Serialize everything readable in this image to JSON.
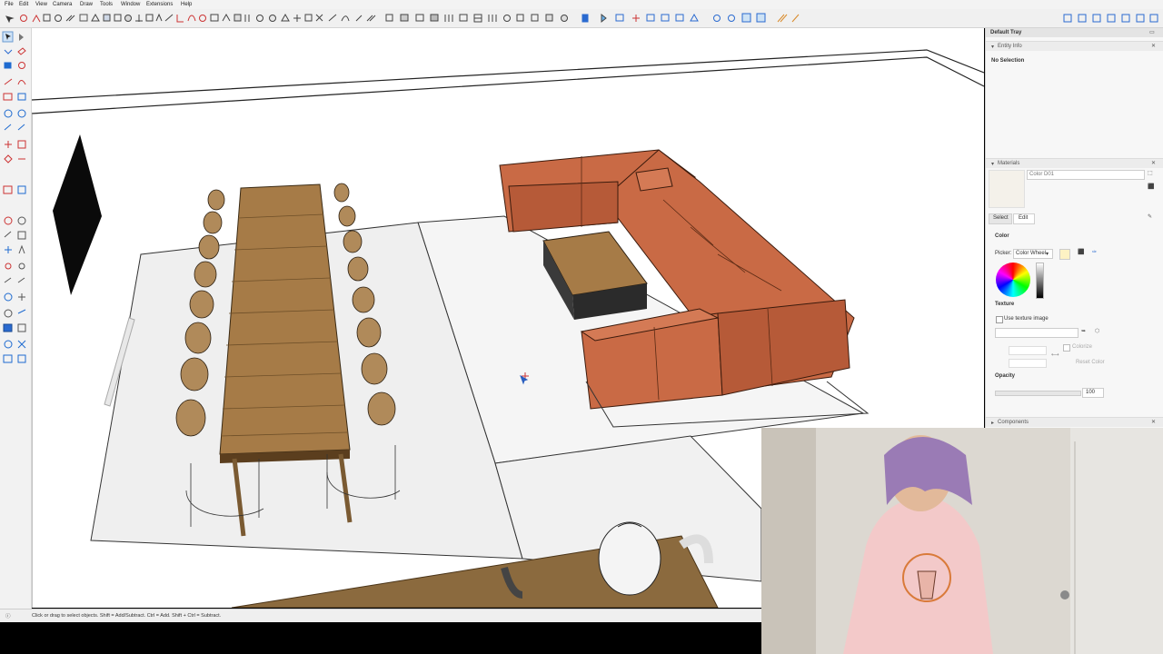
{
  "menu": [
    "File",
    "Edit",
    "View",
    "Camera",
    "Draw",
    "Tools",
    "Window",
    "Extensions",
    "Help"
  ],
  "tray": {
    "title": "Default Tray",
    "entity_info": {
      "header": "Entity Info",
      "selection": "No Selection"
    },
    "materials": {
      "header": "Materials",
      "material_name": "Color D01",
      "tabs": [
        "Select",
        "Edit"
      ],
      "color_label": "Color",
      "picker_label": "Picker:",
      "picker_value": "Color Wheel",
      "texture_label": "Texture",
      "use_texture_label": "Use texture image",
      "colorize_label": "Colorize",
      "reset_color_label": "Reset Color",
      "opacity_label": "Opacity",
      "opacity_value": "100",
      "material_color": "#f4f1ea",
      "swatch_color": "#fdf2c4"
    },
    "components_header": "Components"
  },
  "status": {
    "text": "Click or drag to select objects. Shift = Add/Subtract. Ctrl = Add. Shift + Ctrl = Subtract."
  },
  "colors": {
    "sofa": "#c96a45",
    "wood": "#a67b47",
    "floor_wood": "#8b6a3e",
    "screen": "#0a0a0a",
    "shirt": "#f3c9c9",
    "towel": "#9a7bb5"
  }
}
